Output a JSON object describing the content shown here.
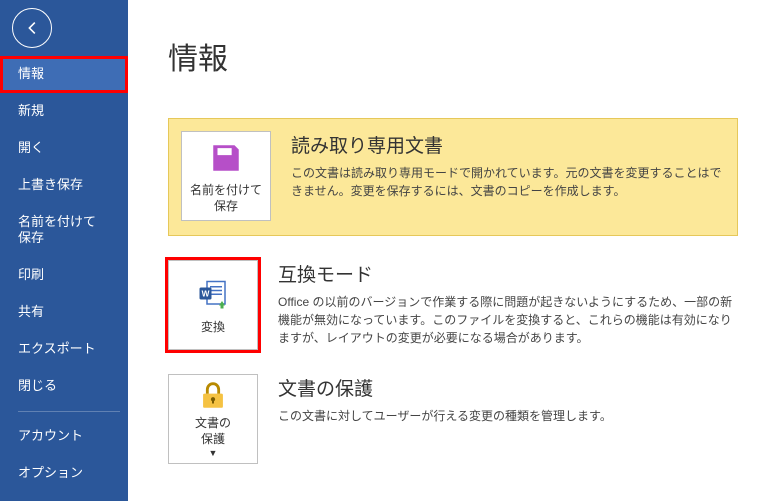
{
  "pageTitle": "情報",
  "sidebar": {
    "items": [
      {
        "label": "情報",
        "selected": true,
        "highlight": true
      },
      {
        "label": "新規"
      },
      {
        "label": "開く"
      },
      {
        "label": "上書き保存"
      },
      {
        "label": "名前を付けて\n保存"
      },
      {
        "label": "印刷"
      },
      {
        "label": "共有"
      },
      {
        "label": "エクスポート"
      },
      {
        "label": "閉じる"
      }
    ],
    "footer": [
      {
        "label": "アカウント"
      },
      {
        "label": "オプション"
      }
    ]
  },
  "sections": {
    "readonly": {
      "btnLabel": "名前を付けて\n保存",
      "title": "読み取り専用文書",
      "desc": "この文書は読み取り専用モードで開かれています。元の文書を変更することはできません。変更を保存するには、文書のコピーを作成します。"
    },
    "compat": {
      "btnLabel": "変換",
      "title": "互換モード",
      "desc": "Office の以前のバージョンで作業する際に問題が起きないようにするため、一部の新機能が無効になっています。このファイルを変換すると、これらの機能は有効になりますが、レイアウトの変更が必要になる場合があります。"
    },
    "protect": {
      "btnLabel": "文書の\n保護",
      "title": "文書の保護",
      "desc": "この文書に対してユーザーが行える変更の種類を管理します。"
    }
  }
}
